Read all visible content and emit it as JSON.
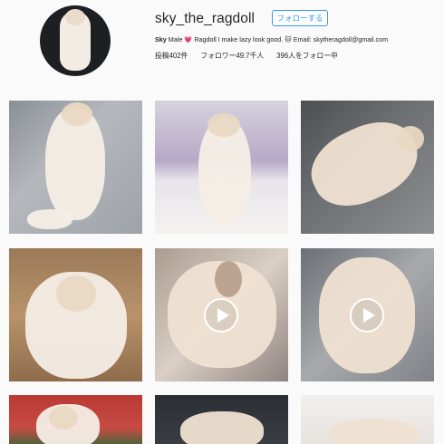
{
  "profile": {
    "username": "sky_the_ragdoll",
    "follow_label": "フォローする",
    "bio_name": "Sky",
    "bio_text": "Male 💗 Ragdoll I make lazy look good. 🐱 Email: skytheragdoll@gmail.com",
    "stats": {
      "posts": "投稿402件",
      "followers": "フォロワー49.7千人",
      "following": "396人をフォロー中"
    }
  },
  "posts": [
    {
      "type": "image",
      "icon": "none"
    },
    {
      "type": "image",
      "icon": "none"
    },
    {
      "type": "image",
      "icon": "none"
    },
    {
      "type": "image",
      "icon": "none"
    },
    {
      "type": "video",
      "icon": "play-icon"
    },
    {
      "type": "video",
      "icon": "play-icon"
    },
    {
      "type": "image",
      "icon": "none"
    },
    {
      "type": "image",
      "icon": "none"
    },
    {
      "type": "image",
      "icon": "none"
    }
  ],
  "colors": {
    "accent": "#3897f0",
    "text": "#262626",
    "background": "#fafafa"
  }
}
